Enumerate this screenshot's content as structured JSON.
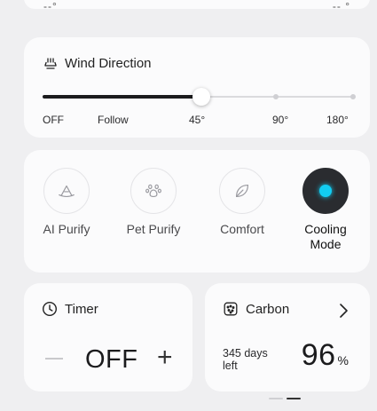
{
  "top_card": {
    "left_text": "--°",
    "right_text": "-- °"
  },
  "wind_direction": {
    "title": "Wind Direction",
    "icon": "wind-direction-icon",
    "labels": [
      "OFF",
      "Follow",
      "45°",
      "90°",
      "180°"
    ],
    "selected": "45°",
    "selected_fraction": 0.51
  },
  "modes": [
    {
      "label": "AI Purify",
      "icon": "ai-purify-icon",
      "active": false
    },
    {
      "label": "Pet Purify",
      "icon": "paw-icon",
      "active": false
    },
    {
      "label": "Comfort",
      "icon": "leaf-icon",
      "active": false
    },
    {
      "label": "Cooling\nMode",
      "icon": "cooling-mode-icon",
      "active": true
    }
  ],
  "timer": {
    "title": "Timer",
    "icon": "clock-icon",
    "value": "OFF",
    "minus": "—",
    "plus": "+"
  },
  "carbon": {
    "title": "Carbon",
    "icon": "filter-icon",
    "days_left": "345 days left",
    "percent_value": "96",
    "percent_symbol": "%"
  },
  "colors": {
    "accent": "#12cdf2",
    "dark": "#2a2c30",
    "background": "#efeff1",
    "card": "#fbfbfc"
  }
}
